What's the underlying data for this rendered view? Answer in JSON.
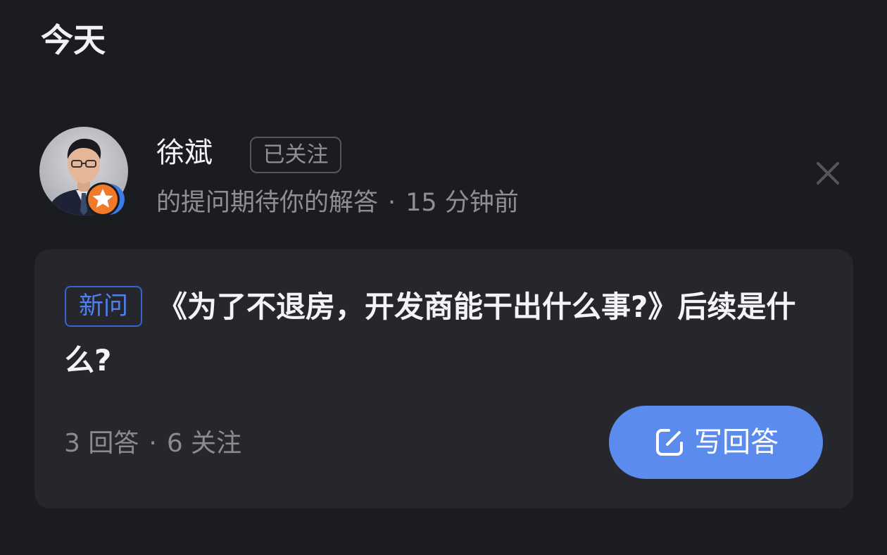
{
  "section": {
    "title": "今天"
  },
  "author": {
    "name": "徐斌",
    "follow_status": "已关注",
    "subtitle_action": "的提问期待你的解答",
    "separator": "·",
    "time_ago": "15 分钟前"
  },
  "question_card": {
    "tag": "新问",
    "title": "《为了不退房，开发商能干出什么事?》后续是什么?",
    "answers": "3 回答",
    "separator": "·",
    "followers": "6 关注",
    "answer_button_label": "写回答"
  },
  "icons": {
    "close": "close-icon",
    "badge": "star-badge-icon",
    "answer": "edit-icon"
  },
  "colors": {
    "background": "#1b1c20",
    "card": "#26272c",
    "accent": "#5b8ced",
    "tag_border": "#3a63d1",
    "badge": "#f07a2a"
  }
}
